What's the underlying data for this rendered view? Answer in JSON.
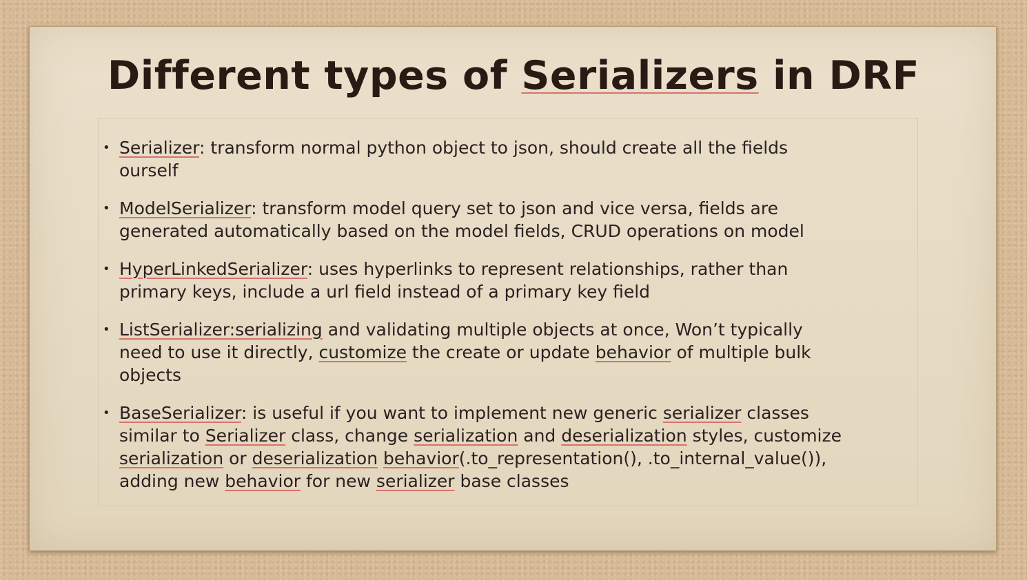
{
  "slide": {
    "title_prefix": "Different types of ",
    "title_underlined": "Serializers",
    "title_suffix": " in DRF",
    "items": [
      {
        "term": "Serializer",
        "sep": ": ",
        "line1": "transform normal python object to json, should create all the fields",
        "line2": "ourself"
      },
      {
        "term": "ModelSerializer",
        "sep": ": ",
        "line1": "transform model query set to json and vice versa, fields are",
        "line2": "generated automatically based on the model fields, CRUD operations on model"
      },
      {
        "term": "HyperLinkedSerializer",
        "sep": ": ",
        "line1": "uses hyperlinks to represent relationships, rather than",
        "line2": "primary keys, include a url field instead of a primary key field"
      },
      {
        "term": "ListSerializer:serializing",
        "line1": " and validating multiple objects at once, Won’t typically",
        "line2a": "need to use it directly, ",
        "line2b": "customize",
        "line2c": " the create or update ",
        "line2d": "behavior",
        "line2e": " of multiple bulk",
        "line3": "objects"
      },
      {
        "term": "BaseSerializer",
        "sep": ":  ",
        "l1a": "is useful if you want to implement new generic ",
        "l1b": "serializer",
        "l1c": " classes",
        "l2a": "similar to ",
        "l2b": "Serializer",
        "l2c": " class, change ",
        "l2d": "serialization",
        "l2e": " and ",
        "l2f": "deserialization",
        "l2g": " styles, customize",
        "l3a": "serialization",
        "l3b": " or ",
        "l3c": "deserialization",
        "l3d": " ",
        "l3e": "behavior",
        "l3f": "(.to_representation(), .to_internal_value()),",
        "l4a": "adding new ",
        "l4b": "behavior",
        "l4c": " for new ",
        "l4d": "serializer",
        "l4e": " base classes"
      }
    ],
    "bullet_glyph": "•"
  }
}
